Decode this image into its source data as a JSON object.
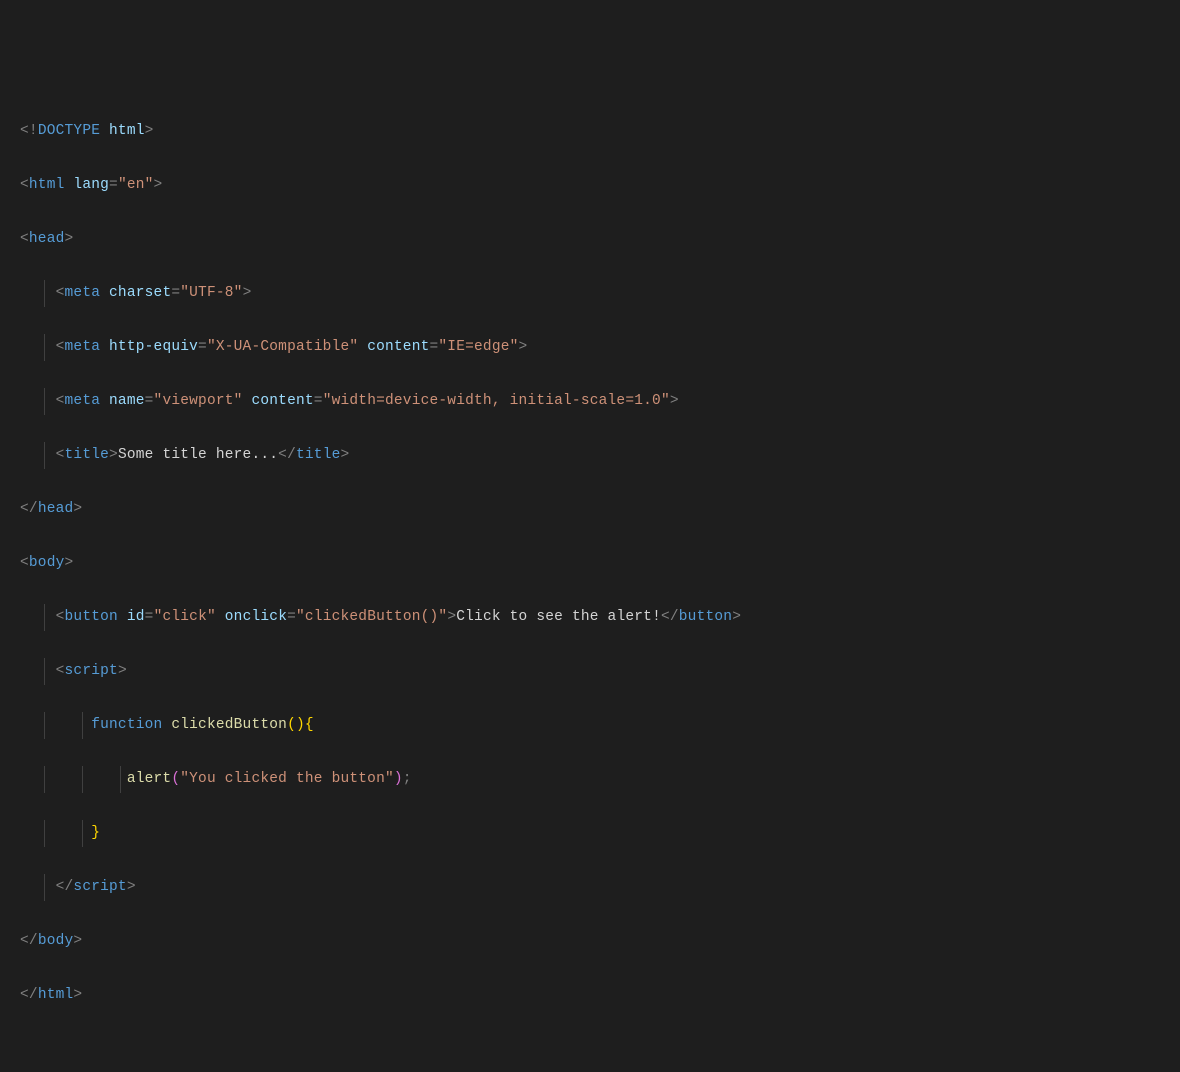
{
  "code": {
    "l1": {
      "doctype1": "<!",
      "doctype2": "DOCTYPE",
      "doctype3": " html",
      "close": ">"
    },
    "l2": {
      "o": "<",
      "tag": "html",
      "sp": " ",
      "attr": "lang",
      "eq": "=",
      "val": "\"en\"",
      "c": ">"
    },
    "l3": {
      "o": "<",
      "tag": "head",
      "c": ">"
    },
    "l4": {
      "o": "<",
      "tag": "meta",
      "sp": " ",
      "attr": "charset",
      "eq": "=",
      "val": "\"UTF-8\"",
      "c": ">"
    },
    "l5": {
      "o": "<",
      "tag": "meta",
      "sp": " ",
      "a1": "http-equiv",
      "eq": "=",
      "v1": "\"X-UA-Compatible\"",
      "sp2": " ",
      "a2": "content",
      "v2": "\"IE=edge\"",
      "c": ">"
    },
    "l6": {
      "o": "<",
      "tag": "meta",
      "sp": " ",
      "a1": "name",
      "eq": "=",
      "v1": "\"viewport\"",
      "sp2": " ",
      "a2": "content",
      "v2": "\"width=device-width, initial-scale=1.0\"",
      "c": ">"
    },
    "l7": {
      "o": "<",
      "tag": "title",
      "c": ">",
      "text": "Some title here...",
      "o2": "</",
      "c2": ">"
    },
    "l8": {
      "o": "</",
      "tag": "head",
      "c": ">"
    },
    "l9": {
      "o": "<",
      "tag": "body",
      "c": ">"
    },
    "l10": {
      "o": "<",
      "tag": "button",
      "sp": " ",
      "a1": "id",
      "eq": "=",
      "v1": "\"click\"",
      "sp2": " ",
      "a2": "onclick",
      "v2": "\"clickedButton()\"",
      "c": ">",
      "text": "Click to see the alert!",
      "o2": "</",
      "c2": ">"
    },
    "l11": {
      "o": "<",
      "tag": "script",
      "c": ">"
    },
    "l12": {
      "kw": "function",
      "sp": " ",
      "name": "clickedButton",
      "op": "(",
      "cp": ")",
      "ob": "{"
    },
    "l13": {
      "fn": "alert",
      "op": "(",
      "str": "\"You clicked the button\"",
      "cp": ")",
      "semi": ";"
    },
    "l14": {
      "cb": "}"
    },
    "l15": {
      "o": "</",
      "tag": "script",
      "c": ">"
    },
    "l16": {
      "o": "</",
      "tag": "body",
      "c": ">"
    },
    "l17": {
      "o": "</",
      "tag": "html",
      "c": ">"
    }
  }
}
